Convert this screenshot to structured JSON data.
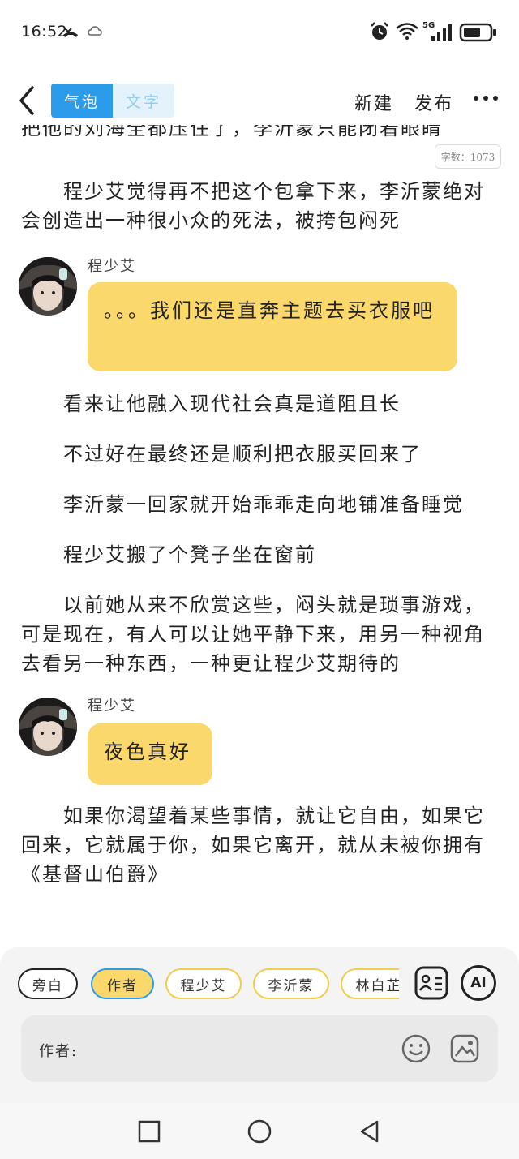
{
  "status_bar": {
    "time": "16:52",
    "network": "5G",
    "icons": [
      "missed-call-icon",
      "cloud-icon",
      "alarm-icon",
      "wifi-icon",
      "signal-icon",
      "battery-icon"
    ]
  },
  "toolbar": {
    "mode_bubble": "气泡",
    "mode_text": "文字",
    "new_label": "新建",
    "publish_label": "发布"
  },
  "content": {
    "partial_line": "把他的刘海全都压住了，李沂蒙只能闭着眼睛",
    "word_count": "字数：1073",
    "para1": "　　程少艾觉得再不把这个包拿下来，李沂蒙绝对会创造出一种很小众的死法，被挎包闷死",
    "bubble1": {
      "speaker": "程少艾",
      "text": "。。。我们还是直奔主题去买衣服吧"
    },
    "para2": "　　看来让他融入现代社会真是道阻且长",
    "para3": "　　不过好在最终还是顺利把衣服买回来了",
    "para4": "　　李沂蒙一回家就开始乖乖走向地铺准备睡觉",
    "para5": "　　程少艾搬了个凳子坐在窗前",
    "para6": "　　以前她从来不欣赏这些，闷头就是琐事游戏，可是现在，有人可以让她平静下来，用另一种视角去看另一种东西，一种更让程少艾期待的",
    "bubble2": {
      "speaker": "程少艾",
      "text": "夜色真好"
    },
    "para7": "　　如果你渴望着某些事情，就让它自由，如果它回来，它就属于你，如果它离开，就从未被你拥有《基督山伯爵》"
  },
  "bottom": {
    "chips": [
      "旁白",
      "作者",
      "程少艾",
      "李沂蒙",
      "林白芷"
    ],
    "ai_label": "AI",
    "input_label": "作者:",
    "input_value": ""
  },
  "colors": {
    "accent_blue": "#2c9bea",
    "bubble_yellow": "#fbd86b"
  }
}
